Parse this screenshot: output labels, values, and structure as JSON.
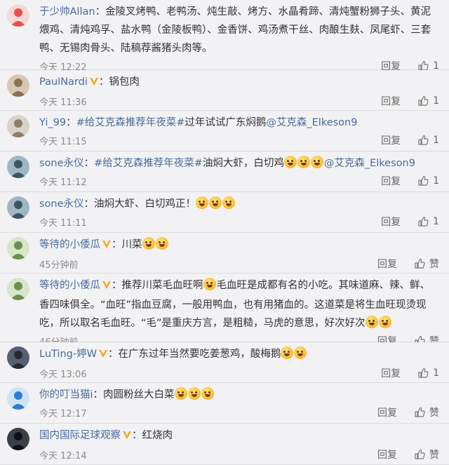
{
  "comments": [
    {
      "user": "于少帅Allan",
      "segments": [
        {
          "type": "text",
          "value": "金陵叉烤鸭、老鸭汤、炖生敲、烤方、水晶肴蹄、清炖蟹粉狮子头、黄泥煨鸡、清炖鸡孚、盐水鸭（金陵板鸭）、金香饼、鸡汤煮干丝、肉酿生麸、凤尾虾、三套鸭、无锡肉骨头、陆稿荐酱猪头肉等。"
        }
      ],
      "time": "今天 12:22",
      "reply_label": "回复",
      "like_value": "1"
    },
    {
      "user": "PaulNardi",
      "badge": "V",
      "segments": [
        {
          "type": "text",
          "value": "锅包肉"
        }
      ],
      "time": "今天 11:36",
      "reply_label": "回复",
      "like_value": "1"
    },
    {
      "user": "Yi_99",
      "segments": [
        {
          "type": "tag",
          "value": "#给艾克森推荐年夜菜#"
        },
        {
          "type": "text",
          "value": "过年试试广东焖鹅"
        },
        {
          "type": "mention",
          "value": "@艾克森_Elkeson9"
        }
      ],
      "time": "今天 11:15",
      "reply_label": "回复",
      "like_value": "1"
    },
    {
      "user": "sone永仪",
      "segments": [
        {
          "type": "tag",
          "value": "#给艾克森推荐年夜菜#"
        },
        {
          "type": "text",
          "value": "油焖大虾，白切鸡"
        },
        {
          "type": "emoji",
          "count": 3
        },
        {
          "type": "mention",
          "value": "@艾克森_Elkeson9"
        }
      ],
      "time": "今天 11:12",
      "reply_label": "回复",
      "like_value": "1"
    },
    {
      "user": "sone永仪",
      "segments": [
        {
          "type": "text",
          "value": "油焖大虾、白切鸡正！"
        },
        {
          "type": "emoji",
          "count": 3
        }
      ],
      "time": "今天 11:11",
      "reply_label": "回复",
      "like_value": "1"
    },
    {
      "user": "等待的小倭瓜",
      "badge": "V",
      "segments": [
        {
          "type": "text",
          "value": "川菜"
        },
        {
          "type": "emoji",
          "count": 2
        }
      ],
      "time": "45分钟前",
      "reply_label": "回复",
      "like_value": "赞"
    },
    {
      "user": "等待的小倭瓜",
      "badge": "V",
      "segments": [
        {
          "type": "text",
          "value": "推荐川菜毛血旺啊"
        },
        {
          "type": "emoji",
          "count": 1
        },
        {
          "type": "text",
          "value": "毛血旺是成都有名的小吃。其味道麻、辣、鲜、香四味俱全。“血旺”指血豆腐，一般用鸭血，也有用猪血的。这道菜是将生血旺现烫现吃，所以取名毛血旺。“毛”是重庆方言，是粗糙，马虎的意思，好次好次"
        },
        {
          "type": "emoji",
          "count": 2
        }
      ],
      "time": "46分钟前",
      "reply_label": "回复",
      "like_value": "赞"
    },
    {
      "user": "LuTing-婷W",
      "badge": "V",
      "segments": [
        {
          "type": "text",
          "value": "在广东过年当然要吃姜葱鸡，酸梅鹅"
        },
        {
          "type": "emoji",
          "count": 2
        }
      ],
      "time": "今天 13:06",
      "reply_label": "回复",
      "like_value": "1"
    },
    {
      "user": "你的叮当猫i",
      "segments": [
        {
          "type": "text",
          "value": "肉圆粉丝大白菜"
        },
        {
          "type": "emoji",
          "count": 3
        }
      ],
      "time": "今天 12:17",
      "reply_label": "回复",
      "like_value": "赞"
    },
    {
      "user": "国内国际足球观察",
      "badge": "V",
      "segments": [
        {
          "type": "text",
          "value": "红烧肉"
        }
      ],
      "time": "今天 12:14",
      "reply_label": "回复",
      "like_value": "赞"
    }
  ],
  "colors": {
    "username": "#4a6a9a",
    "badge_gold": "#f5a623",
    "meta": "#8a8a8a",
    "background": "#f2f2f5"
  }
}
